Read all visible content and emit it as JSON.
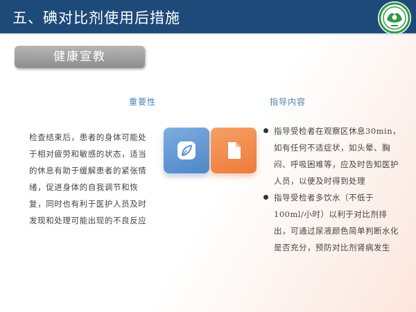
{
  "header": {
    "title": "五、碘对比剂使用后措施",
    "logo_icon": "green-circular-emblem-icon"
  },
  "section": {
    "label": "健康宣教"
  },
  "columns": {
    "left_heading": "重要性",
    "right_heading": "指导内容"
  },
  "left_text": "检查结束后，患者的身体可能处于相对疲劳和敏感的状态，适当的休息有助于缓解患者的紧张情绪，促进身体的自我调节和恢复，同时也有利于医护人员及时发现和处理可能出现的不良反应",
  "icons": {
    "left": "leaf-pen-icon",
    "right": "document-icon"
  },
  "bullets": [
    "指导受检者在观察区休息30min，如有任何不适症状，如头晕、胸闷、呼吸困难等，应及时告知医护人员，以便及时得到处理",
    "指导受检者多饮水（不低于100ml/小时）以利于对比剂排出，可通过尿液颜色简单判断水化是否充分，预防对比剂肾病发生"
  ],
  "colors": {
    "title_bar": "#1e4a7a",
    "heading": "#4b7fb3",
    "card_blue": "#5b92d0",
    "card_orange": "#f08a4b",
    "logo_green": "#2f9a45"
  }
}
